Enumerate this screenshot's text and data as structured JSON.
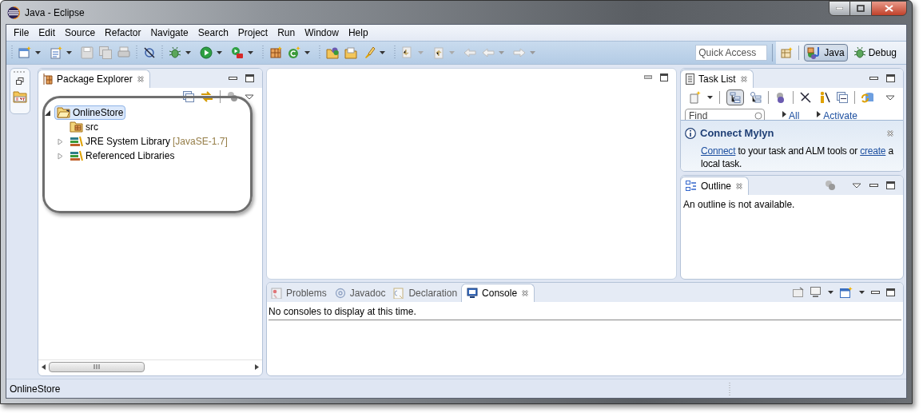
{
  "window": {
    "title": "Java - Eclipse"
  },
  "menu": [
    "File",
    "Edit",
    "Source",
    "Refactor",
    "Navigate",
    "Search",
    "Project",
    "Run",
    "Window",
    "Help"
  ],
  "quick_access": {
    "placeholder": "Quick Access"
  },
  "perspectives": [
    {
      "label": "Java",
      "selected": true
    },
    {
      "label": "Debug",
      "selected": false
    }
  ],
  "package_explorer": {
    "title": "Package Explorer",
    "tree": [
      {
        "kind": "project",
        "label": "OnlineStore",
        "selected": true,
        "expanded": true,
        "children": [
          {
            "kind": "folder",
            "label": "src",
            "selected": false
          },
          {
            "kind": "library",
            "label": "JRE System Library",
            "decoration": "[JavaSE-1.7]",
            "selected": false,
            "expanded": false
          },
          {
            "kind": "library",
            "label": "Referenced Libraries",
            "selected": false,
            "expanded": false
          }
        ]
      }
    ]
  },
  "task_list": {
    "title": "Task List",
    "find": {
      "placeholder": "Find"
    },
    "links": [
      "All",
      "Activate"
    ],
    "mylyn": {
      "title": "Connect Mylyn",
      "parts": [
        {
          "kind": "link",
          "text": "Connect"
        },
        {
          "kind": "text",
          "text": " to your task and ALM tools or "
        },
        {
          "kind": "link",
          "text": "create"
        },
        {
          "kind": "text",
          "text": " a local task."
        }
      ]
    }
  },
  "outline": {
    "title": "Outline",
    "message": "An outline is not available."
  },
  "bottom_tabs": [
    {
      "kind": "problems",
      "label": "Problems",
      "selected": false
    },
    {
      "kind": "javadoc",
      "label": "Javadoc",
      "selected": false
    },
    {
      "kind": "declaration",
      "label": "Declaration",
      "selected": false
    },
    {
      "kind": "console",
      "label": "Console",
      "selected": true
    }
  ],
  "console": {
    "message": "No consoles to display at this time."
  },
  "status_bar": {
    "text": "OnlineStore"
  }
}
